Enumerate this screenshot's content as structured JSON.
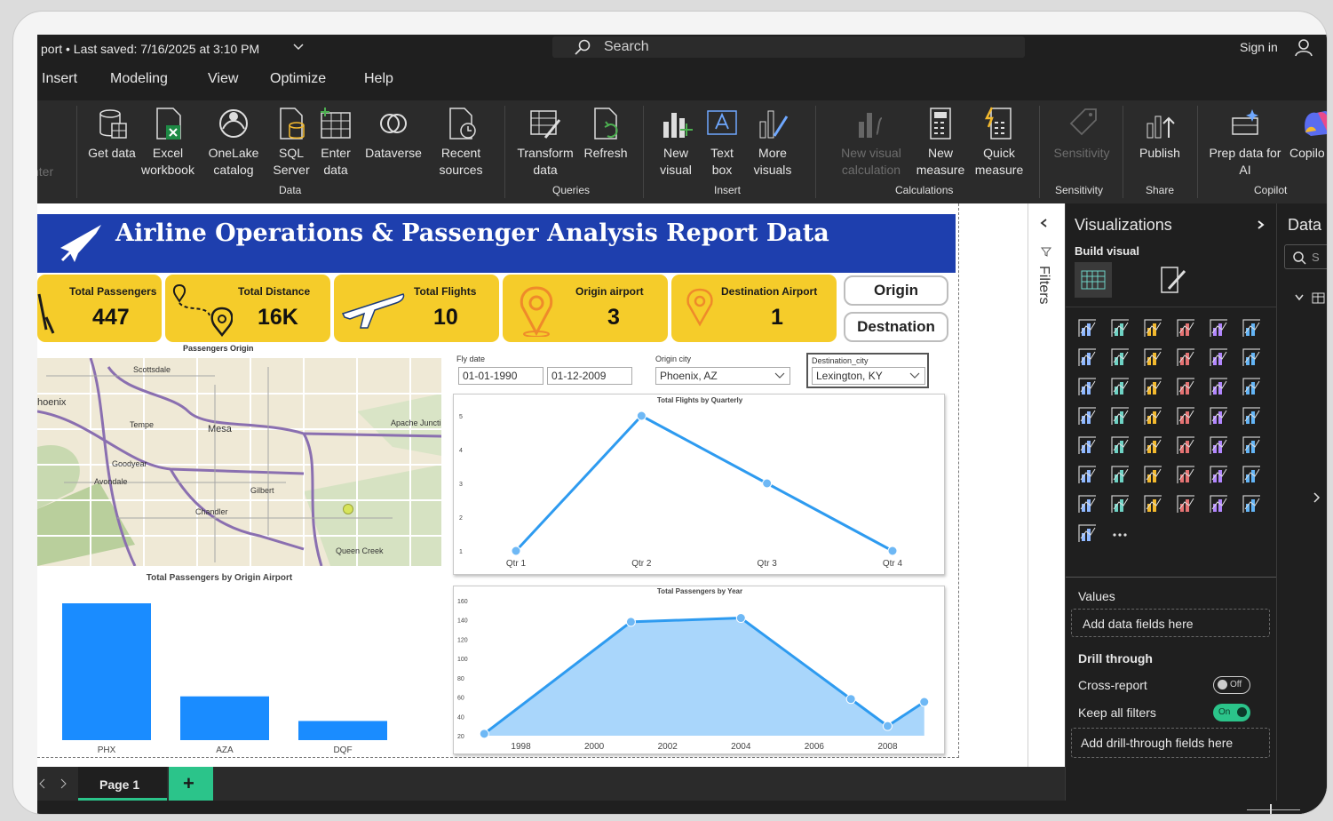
{
  "app": {
    "title_bar": "port • Last saved: 7/16/2025 at 3:10 PM",
    "search_placeholder": "Search",
    "sign_in": "Sign in"
  },
  "menu": [
    "Insert",
    "Modeling",
    "View",
    "Optimize",
    "Help"
  ],
  "ribbon": {
    "cut_label": "nter",
    "buttons": {
      "get_data": "Get data",
      "excel": "Excel workbook",
      "onelake": "OneLake catalog",
      "sql": "SQL Server",
      "enter_data": "Enter data",
      "dataverse": "Dataverse",
      "recent": "Recent sources",
      "transform": "Transform data",
      "refresh": "Refresh",
      "new_visual": "New visual",
      "text_box": "Text box",
      "more_visuals": "More visuals",
      "new_visual_calc": "New visual calculation",
      "new_measure": "New measure",
      "quick_measure": "Quick measure",
      "sensitivity": "Sensitivity",
      "publish": "Publish",
      "prep_ai": "Prep data for AI",
      "copilot": "Copilo"
    },
    "groups": {
      "data": "Data",
      "queries": "Queries",
      "insert": "Insert",
      "calculations": "Calculations",
      "sensitivity": "Sensitivity",
      "share": "Share",
      "copilot": "Copilot"
    }
  },
  "report": {
    "title": "Airline Operations & Passenger Analysis Report Data",
    "kpis": [
      {
        "label": "Total Passengers",
        "value": "447"
      },
      {
        "label": "Total Distance",
        "value": "16K"
      },
      {
        "label": "Total Flights",
        "value": "10"
      },
      {
        "label": "Origin airport",
        "value": "3"
      },
      {
        "label": "Destination Airport",
        "value": "1"
      }
    ],
    "buttons": {
      "origin": "Origin",
      "destination": "Destnation"
    },
    "map": {
      "title": "Passengers Origin",
      "places": [
        "Scottsdale",
        "hoenix",
        "Tempe",
        "Mesa",
        "Apache Juncti",
        "Gilbert",
        "Chandler",
        "Queen Creek",
        "Avondale",
        "Goodyear"
      ]
    },
    "slicers": {
      "date_label": "Fly date",
      "date_from": "01-01-1990",
      "date_to": "01-12-2009",
      "origin_label": "Origin city",
      "origin_value": "Phoenix, AZ",
      "dest_label": "Destination_city",
      "dest_value": "Lexington, KY"
    }
  },
  "chart_data": [
    {
      "type": "line",
      "title": "Total Flights by Quarterly",
      "categories": [
        "Qtr 1",
        "Qtr 2",
        "Qtr 3",
        "Qtr 4"
      ],
      "values": [
        1,
        5,
        3,
        1
      ],
      "ylim": [
        1,
        5
      ],
      "yticks": [
        "1",
        "2",
        "3",
        "4",
        "5"
      ],
      "color": "#2e9bf0"
    },
    {
      "type": "bar",
      "title": "Total Passengers by Origin Airport",
      "categories": [
        "PHX",
        "AZA",
        "DQF"
      ],
      "values": [
        250,
        80,
        35
      ],
      "ylim": [
        0,
        250
      ],
      "color": "#1a8cff"
    },
    {
      "type": "area",
      "title": "Total Passengers by Year",
      "x": [
        1997,
        2001,
        2004,
        2007,
        2008,
        2009
      ],
      "values": [
        22,
        138,
        142,
        58,
        30,
        55
      ],
      "xticks": [
        "1998",
        "2000",
        "2002",
        "2004",
        "2006",
        "2008"
      ],
      "yticks": [
        "20",
        "40",
        "60",
        "80",
        "100",
        "120",
        "140",
        "160"
      ],
      "ylim": [
        20,
        160
      ],
      "color": "#2e9bf0"
    }
  ],
  "filters_label": "Filters",
  "viz_pane": {
    "title": "Visualizations",
    "build": "Build visual",
    "values_label": "Values",
    "values_placeholder": "Add data fields here",
    "drill": "Drill through",
    "cross_report": "Cross-report",
    "cross_state": "Off",
    "keep_filters": "Keep all filters",
    "keep_state": "On",
    "drill_placeholder": "Add drill-through fields here"
  },
  "data_pane": {
    "title": "Data",
    "search_placeholder": "S"
  },
  "pages": {
    "current": "Page 1",
    "add": "+"
  }
}
